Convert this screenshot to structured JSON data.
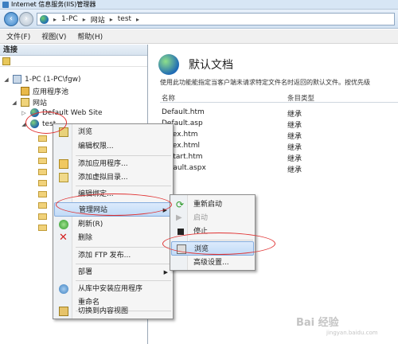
{
  "window": {
    "title": "Internet 信息服务(IIS)管理器"
  },
  "address": {
    "crumbs": [
      "1-PC",
      "网站",
      "test"
    ]
  },
  "menu": {
    "items": [
      "文件(F)",
      "视图(V)",
      "帮助(H)"
    ]
  },
  "connections": {
    "header": "连接",
    "tree": [
      {
        "label": "1-PC (1-PC\\fgw)"
      },
      {
        "label": "应用程序池"
      },
      {
        "label": "网站"
      },
      {
        "label": "Default Web Site"
      },
      {
        "label": "test"
      }
    ]
  },
  "feature": {
    "title": "默认文档",
    "description": "使用此功能能指定当客户端未请求特定文件名时返回的默认文件。按优先级",
    "columns": [
      "名称",
      "条目类型"
    ],
    "rows": [
      {
        "name": "Default.htm",
        "type": "继承"
      },
      {
        "name": "Default.asp",
        "type": "继承"
      },
      {
        "name": "index.htm",
        "type": "继承"
      },
      {
        "name": "index.html",
        "type": "继承"
      },
      {
        "name": "iisstart.htm",
        "type": "继承"
      },
      {
        "name": "default.aspx",
        "type": "继承"
      }
    ]
  },
  "context_menu": {
    "items": [
      "浏览",
      "编辑权限...",
      "添加应用程序...",
      "添加虚拟目录...",
      "编辑绑定...",
      "管理网站",
      "刷新(R)",
      "删除",
      "添加 FTP 发布...",
      "部署",
      "从库中安装应用程序",
      "重命名",
      "切换到内容视图"
    ]
  },
  "submenu": {
    "items": [
      "重新启动",
      "启动",
      "停止",
      "浏览",
      "高级设置..."
    ]
  },
  "watermark": {
    "brand": "Bai 经验",
    "url": "jingyan.baidu.com"
  },
  "colors": {
    "highlight": "#c1dbf7",
    "annotation": "#e03131",
    "accent": "#1f6bb5"
  }
}
